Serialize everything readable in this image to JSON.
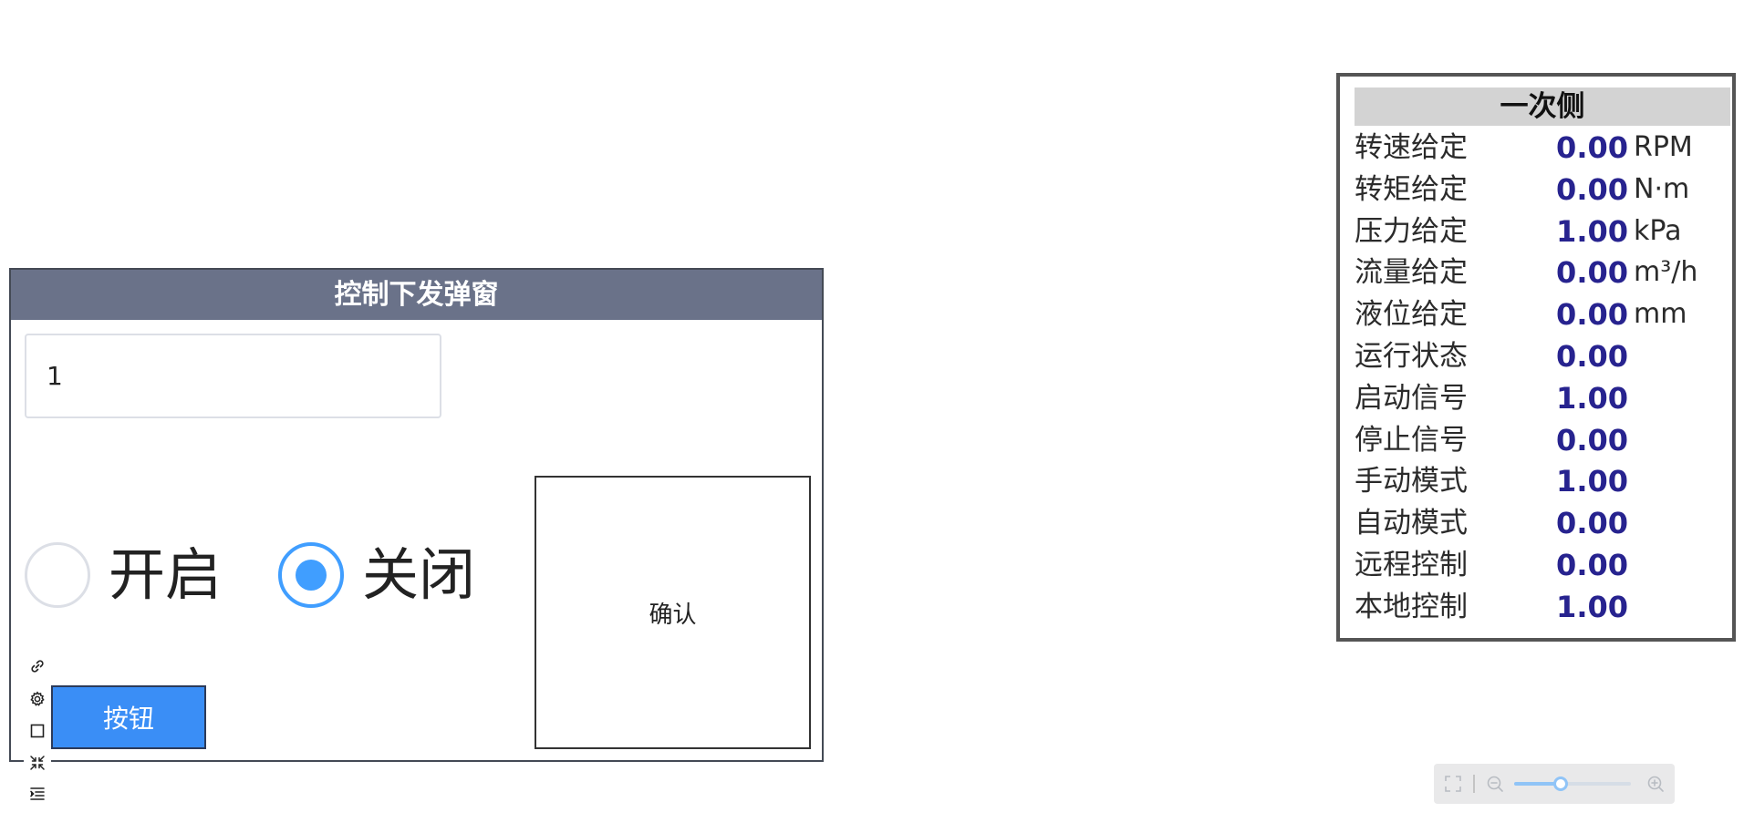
{
  "dialog": {
    "title": "控制下发弹窗",
    "input_value": "1",
    "radio_options": [
      {
        "label": "开启",
        "checked": false
      },
      {
        "label": "关闭",
        "checked": true
      }
    ],
    "confirm_label": "确认",
    "button_label": "按钮"
  },
  "toolbar": {
    "icons": [
      "link-icon",
      "gear-icon",
      "square-icon",
      "collapse-icon",
      "indent-icon"
    ]
  },
  "panel": {
    "title": "一次侧",
    "rows": [
      {
        "label": "转速给定",
        "value": "0.00",
        "unit": "RPM"
      },
      {
        "label": "转矩给定",
        "value": "0.00",
        "unit": "N·m"
      },
      {
        "label": "压力给定",
        "value": "1.00",
        "unit": "kPa"
      },
      {
        "label": "流量给定",
        "value": "0.00",
        "unit": "m³/h"
      },
      {
        "label": "液位给定",
        "value": "0.00",
        "unit": "mm"
      },
      {
        "label": "运行状态",
        "value": "0.00",
        "unit": ""
      },
      {
        "label": "启动信号",
        "value": "1.00",
        "unit": ""
      },
      {
        "label": "停止信号",
        "value": "0.00",
        "unit": ""
      },
      {
        "label": "手动模式",
        "value": "1.00",
        "unit": ""
      },
      {
        "label": "自动模式",
        "value": "0.00",
        "unit": ""
      },
      {
        "label": "远程控制",
        "value": "0.00",
        "unit": ""
      },
      {
        "label": "本地控制",
        "value": "1.00",
        "unit": ""
      }
    ],
    "value_color": "#27238f"
  },
  "zoom": {
    "level": 0.4,
    "icons": [
      "fullscreen-icon",
      "zoom-out-icon",
      "zoom-in-icon"
    ]
  },
  "colors": {
    "dialog_header": "#6a7289",
    "accent": "#409eff",
    "button": "#3a8ef6"
  }
}
